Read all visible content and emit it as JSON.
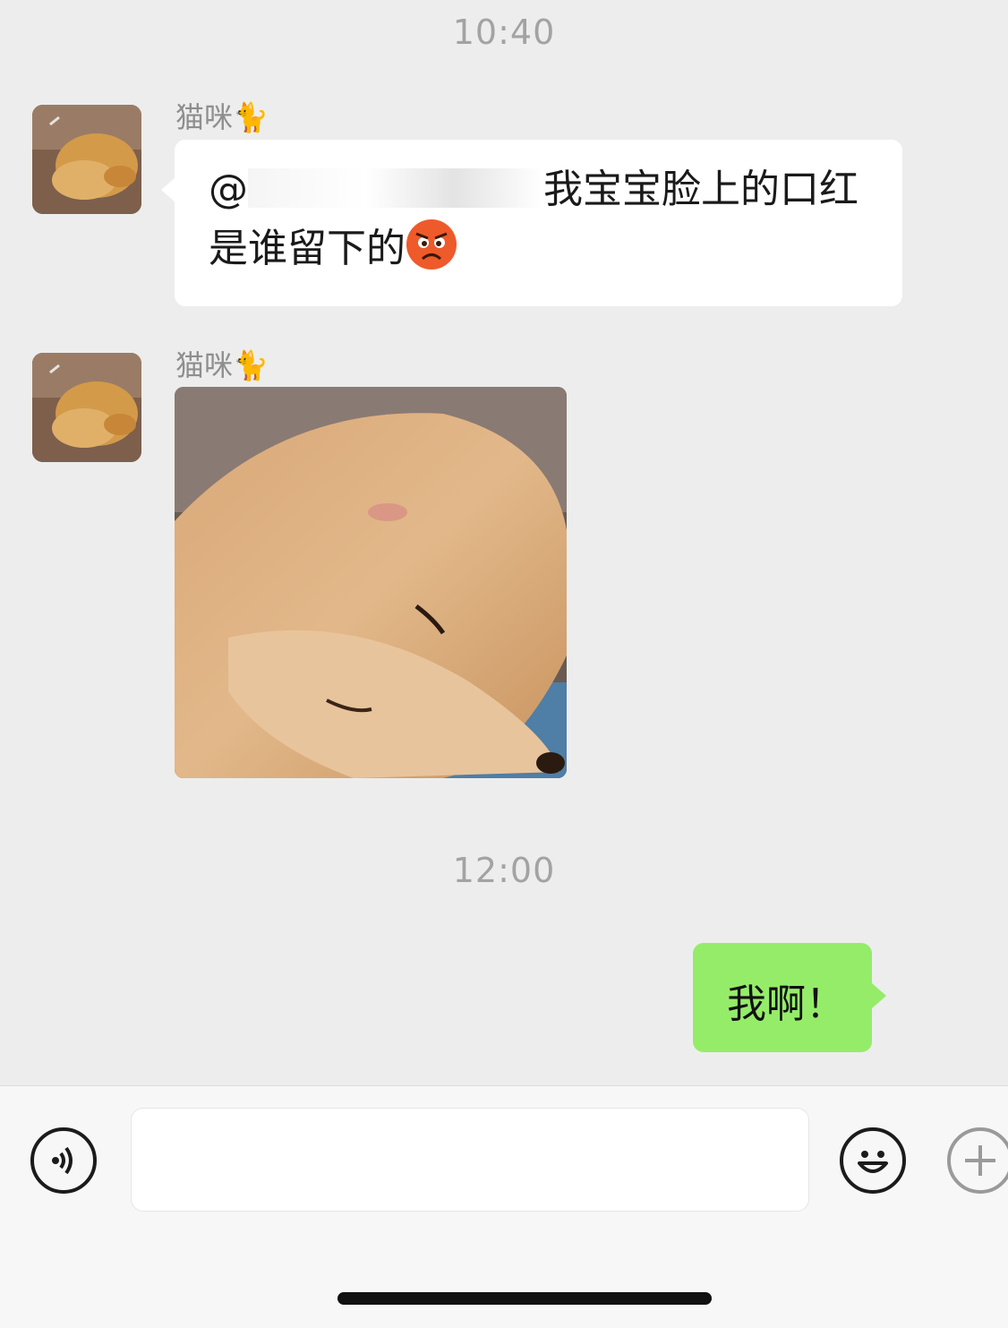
{
  "chat": {
    "timestamps": [
      "10:40",
      "12:00"
    ],
    "sender_name": "猫咪🐈",
    "messages": {
      "first_text_mention": "@",
      "first_text_body": "我宝宝脸上的口红是谁留下的",
      "my_reply": "我啊！"
    }
  },
  "input_bar": {
    "placeholder": ""
  },
  "colors": {
    "background": "#ededed",
    "my_bubble": "#95ec69",
    "their_bubble": "#ffffff",
    "timestamp": "#a3a3a3"
  },
  "icons": {
    "voice": "voice-icon",
    "emoji": "emoji-icon",
    "plus": "plus-icon",
    "angry_face": "angry-face-emoji"
  }
}
